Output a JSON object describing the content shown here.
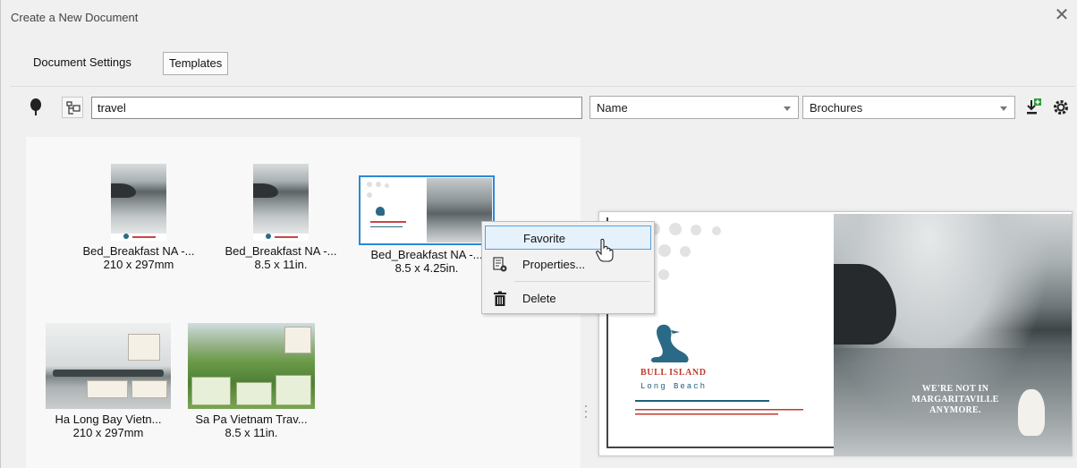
{
  "window": {
    "title": "Create a New Document"
  },
  "tabs": [
    {
      "label": "Document Settings",
      "active": false
    },
    {
      "label": "Templates",
      "active": true
    }
  ],
  "toolbar": {
    "search_value": "travel",
    "sort_select": "Name",
    "category_select": "Brochures"
  },
  "templates": [
    {
      "name": "Bed_Breakfast NA -...",
      "size": "210 x 297mm"
    },
    {
      "name": "Bed_Breakfast NA -...",
      "size": "8.5 x 11in."
    },
    {
      "name": "Bed_Breakfast NA -...",
      "size": "8.5 x 4.25in.",
      "selected": true
    },
    {
      "name": "Ha Long Bay Vietn...",
      "size": "210 x 297mm"
    },
    {
      "name": "Sa Pa Vietnam Trav...",
      "size": "8.5 x 11in."
    }
  ],
  "context_menu": {
    "items": [
      {
        "label": "Favorite",
        "icon": "none",
        "hover": true
      },
      {
        "label": "Properties...",
        "icon": "properties-icon"
      },
      {
        "label": "Delete",
        "icon": "trash-icon"
      }
    ]
  },
  "preview": {
    "brand_title": "BULL ISLAND",
    "brand_sub": "Long Beach",
    "headline_lines": [
      "WE'RE NOT IN",
      "MARGARITAVILLE",
      "ANYMORE."
    ]
  },
  "colors": {
    "accent": "#2b8ad6",
    "brand_red": "#c0392b",
    "brand_teal": "#1f5f7a"
  }
}
